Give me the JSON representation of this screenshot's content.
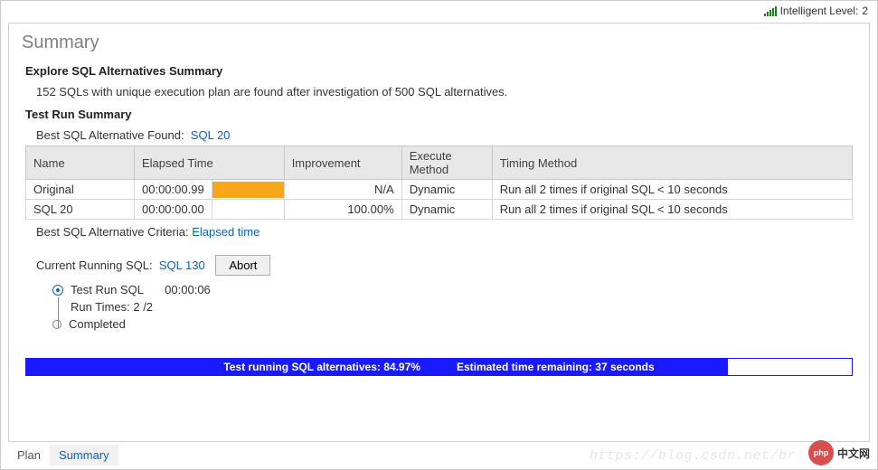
{
  "status": {
    "label": "Intelligent Level:",
    "value": "2"
  },
  "page_title": "Summary",
  "explore": {
    "heading": "Explore SQL Alternatives Summary",
    "text": "152 SQLs with unique execution plan are found after investigation of 500 SQL alternatives."
  },
  "testrun": {
    "heading": "Test Run Summary",
    "best_label": "Best SQL Alternative Found:",
    "best_value": "SQL 20",
    "columns": [
      "Name",
      "Elapsed Time",
      "Improvement",
      "Execute Method",
      "Timing Method"
    ],
    "rows": [
      {
        "name": "Original",
        "elapsed": "00:00:00.99",
        "bar": 100,
        "improvement": "N/A",
        "execute": "Dynamic",
        "timing": "Run all 2 times if original SQL < 10 seconds"
      },
      {
        "name": "SQL 20",
        "elapsed": "00:00:00.00",
        "bar": 0,
        "improvement": "100.00%",
        "execute": "Dynamic",
        "timing": "Run all 2 times if original SQL < 10 seconds"
      }
    ],
    "criteria_label": "Best SQL Alternative Criteria:",
    "criteria_value": "Elapsed time"
  },
  "running": {
    "label": "Current Running SQL:",
    "sql": "SQL 130",
    "abort": "Abort",
    "line1a": "Test Run SQL",
    "line1b": "00:00:06",
    "line2": "Run Times: 2 /2",
    "line3": "Completed"
  },
  "progress": {
    "percent": 84.97,
    "text1": "Test running SQL alternatives: 84.97%",
    "text2": "Estimated time remaining: 37 seconds"
  },
  "tabs": {
    "plan": "Plan",
    "summary": "Summary"
  },
  "watermark": "https://blog.csdn.net/br",
  "logo": {
    "php": "php",
    "cn": "中文网"
  }
}
